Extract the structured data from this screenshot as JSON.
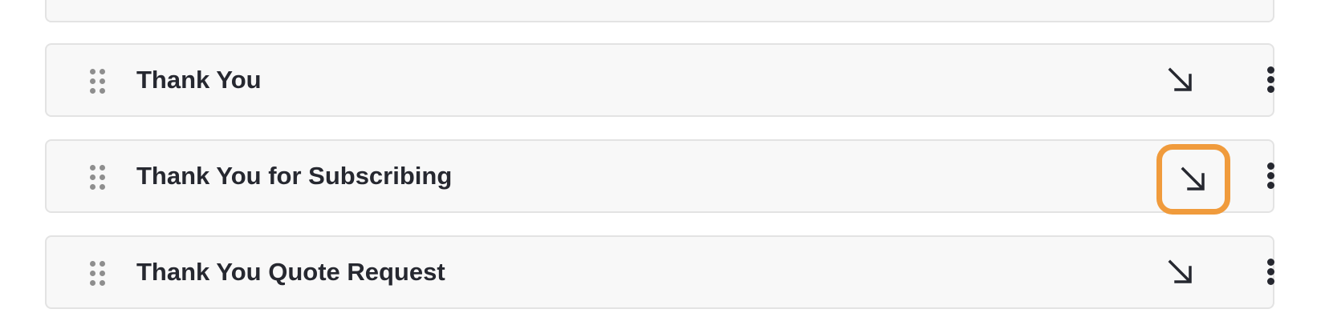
{
  "rows": [
    {
      "title": "Thank You",
      "drag_icon": "drag-handle-icon",
      "collapse_icon": "arrow-down-right-icon",
      "more_icon": "more-vertical-icon",
      "focused": false
    },
    {
      "title": "Thank You for Subscribing",
      "drag_icon": "drag-handle-icon",
      "collapse_icon": "arrow-down-right-icon",
      "more_icon": "more-vertical-icon",
      "focused": true
    },
    {
      "title": "Thank You Quote Request",
      "drag_icon": "drag-handle-icon",
      "collapse_icon": "arrow-down-right-icon",
      "more_icon": "more-vertical-icon",
      "focused": false
    }
  ],
  "colors": {
    "row_background": "#f8f8f8",
    "row_border": "#e3e3e3",
    "text": "#262830",
    "drag_dots": "#8e8e8e",
    "focus_ring": "#f09b3c"
  }
}
